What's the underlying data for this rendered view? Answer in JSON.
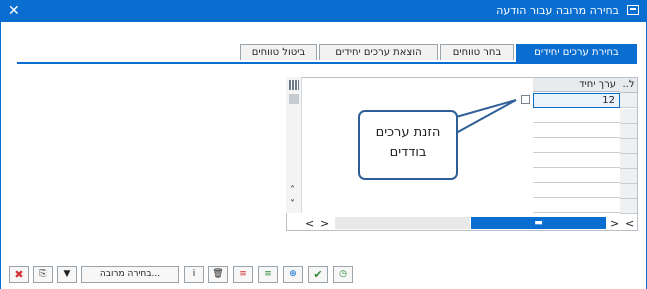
{
  "window": {
    "title": "בחירה מרובה עבור הודעה",
    "close_label": "✕"
  },
  "tabs": [
    {
      "label": "בחירת ערכים יחידים",
      "active": true
    },
    {
      "label": "בחר טווחים",
      "active": false
    },
    {
      "label": "הוצאת ערכים יחידים",
      "active": false
    },
    {
      "label": "ביטול טווחים",
      "active": false
    }
  ],
  "grid": {
    "header": {
      "col_label": "ערך יחיד",
      "first_col_label": "ל..",
      "grid_icon": "table-settings-icon"
    },
    "first_value": "12",
    "nav_buttons": {
      "left": "<",
      "right": ">",
      "up": "˄",
      "down": "˅",
      "page_right": ">",
      "page_left": "<",
      "bar_handle": "▬"
    }
  },
  "callout": {
    "text_line1": "הזנת ערכים",
    "text_line2": "בודדים"
  },
  "toolbar": {
    "more_selection_label": "בחירה מרובה...",
    "icons": [
      "execute-icon",
      "check-icon",
      "copy-icon",
      "insert-row-icon",
      "delete-row-icon",
      "trash-icon",
      "info-icon",
      "filter-icon",
      "import-icon",
      "cancel-icon"
    ]
  },
  "colors": {
    "accent": "#0a6ed1",
    "callout_border": "#2e5f96",
    "ok_green": "#2e8b3e",
    "cancel_red": "#d43333"
  }
}
